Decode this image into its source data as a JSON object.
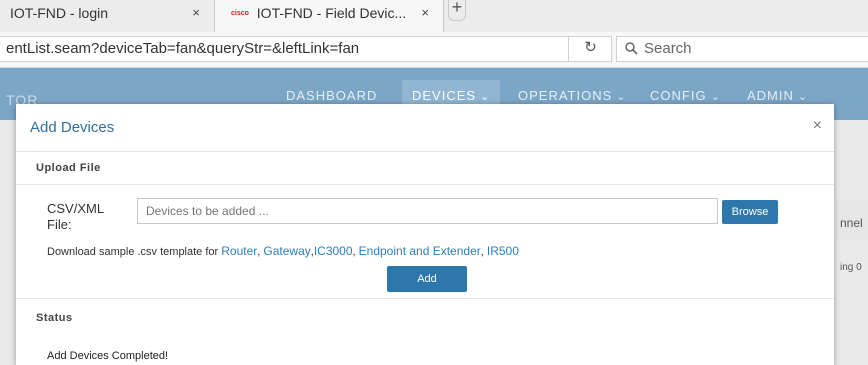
{
  "browser": {
    "tabs": [
      {
        "title": "IOT-FND - login"
      },
      {
        "title": "IOT-FND - Field Devic..."
      }
    ],
    "tab_close_glyph": "×",
    "new_tab_glyph": "+",
    "favicon_text": "cisco",
    "url": "entList.seam?deviceTab=fan&queryStr=&leftLink=fan",
    "search_placeholder": "Search"
  },
  "app_header": {
    "brand": "TOR",
    "nav": [
      {
        "label": "DASHBOARD"
      },
      {
        "label": "DEVICES"
      },
      {
        "label": "OPERATIONS"
      },
      {
        "label": "CONFIG"
      },
      {
        "label": "ADMIN"
      }
    ]
  },
  "background": {
    "right_text_1": "nnel",
    "right_text_2": "ing 0"
  },
  "modal": {
    "title": "Add Devices",
    "close_glyph": "×",
    "upload_heading": "Upload File",
    "csv_label": "CSV/XML File:",
    "csv_placeholder": "Devices to be added ...",
    "browse_label": "Browse",
    "sample_prefix": "Download sample .csv template for ",
    "links": [
      "Router",
      "Gateway",
      "IC3000",
      "Endpoint and Extender",
      "IR500"
    ],
    "add_label": "Add",
    "status_heading": "Status",
    "status_text": "Add Devices Completed!"
  },
  "colors": {
    "header_bg": "#7ca6c6",
    "active_nav_bg": "#90b6d3",
    "primary_button": "#2e77ab",
    "link": "#2f7fb9",
    "modal_title": "#2f6f9f"
  }
}
